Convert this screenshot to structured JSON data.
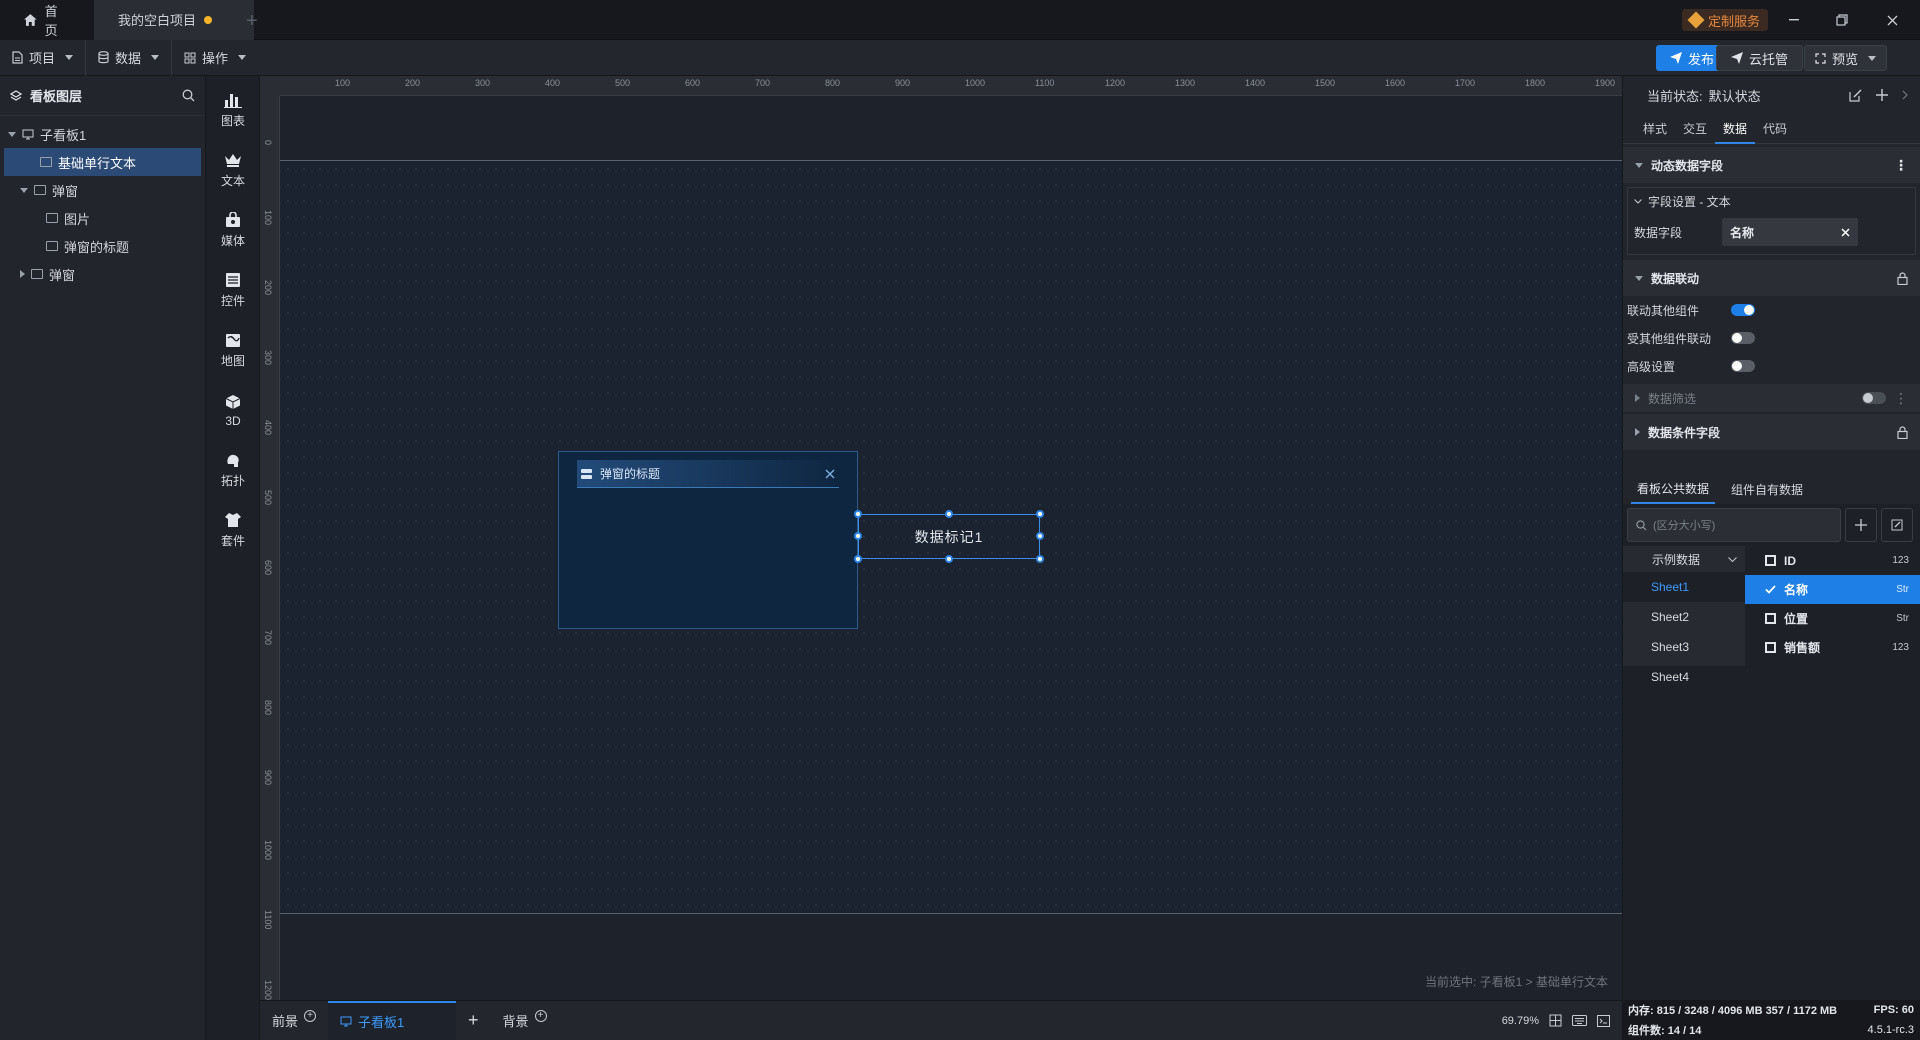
{
  "titlebar": {
    "home_tab": "首页",
    "project_tab": "我的空白项目",
    "custom_service": "定制服务"
  },
  "toolbar": {
    "menu_project": "项目",
    "menu_data": "数据",
    "menu_operate": "操作",
    "publish": "发布",
    "cloud_host": "云托管",
    "preview": "预览"
  },
  "layers": {
    "title": "看板图层",
    "items": [
      {
        "label": "子看板1"
      },
      {
        "label": "基础单行文本"
      },
      {
        "label": "弹窗"
      },
      {
        "label": "图片"
      },
      {
        "label": "弹窗的标题"
      },
      {
        "label": "弹窗"
      }
    ]
  },
  "components": [
    {
      "label": "图表",
      "icon": "bar-chart-icon"
    },
    {
      "label": "文本",
      "icon": "text-crown-icon"
    },
    {
      "label": "媒体",
      "icon": "media-icon"
    },
    {
      "label": "控件",
      "icon": "control-icon"
    },
    {
      "label": "地图",
      "icon": "map-icon"
    },
    {
      "label": "3D",
      "icon": "cube-icon"
    },
    {
      "label": "拓扑",
      "icon": "topology-icon"
    },
    {
      "label": "套件",
      "icon": "kit-icon"
    }
  ],
  "ruler": {
    "h_ticks": [
      "100",
      "200",
      "300",
      "400",
      "500",
      "600",
      "700",
      "800",
      "900",
      "1000",
      "1100",
      "1200",
      "1300",
      "1400",
      "1500",
      "1600",
      "1700",
      "1800",
      "1900"
    ],
    "v_ticks": [
      "0",
      "100",
      "200",
      "300",
      "400",
      "500",
      "600",
      "700",
      "800",
      "900",
      "1000",
      "1100",
      "1200"
    ]
  },
  "canvas": {
    "popup_title": "弹窗的标题",
    "text_widget": "数据标记1",
    "status_text": "当前选中: 子看板1 > 基础单行文本"
  },
  "bottom_tabs": {
    "foreground": "前景",
    "sub_board": "子看板1",
    "background": "背景",
    "zoom": "69.79%"
  },
  "right_panel": {
    "state_label": "当前状态:",
    "state_value": "默认状态",
    "tabs": [
      "样式",
      "交互",
      "数据",
      "代码"
    ],
    "active_tab": "数据",
    "dynamic_fields": "动态数据字段",
    "field_setting": "字段设置 - 文本",
    "data_field_label": "数据字段",
    "data_field_value": "名称",
    "data_linkage": "数据联动",
    "link_other": "联动其他组件",
    "linked_by_other": "受其他组件联动",
    "advanced": "高级设置",
    "data_filter": "数据筛选",
    "condition_fields": "数据条件字段",
    "data_tabs": [
      "看板公共数据",
      "组件自有数据"
    ],
    "search_placeholder": "(区分大小写)",
    "dataset": "示例数据",
    "sheets": [
      "Sheet1",
      "Sheet2",
      "Sheet3",
      "Sheet4"
    ],
    "fields": [
      {
        "name": "ID",
        "type": "123",
        "checked": false
      },
      {
        "name": "名称",
        "type": "Str",
        "checked": true
      },
      {
        "name": "位置",
        "type": "Str",
        "checked": false
      },
      {
        "name": "销售额",
        "type": "123",
        "checked": false
      }
    ],
    "toggles": {
      "link_other": true,
      "linked_by_other": false,
      "advanced": false,
      "data_filter": false
    },
    "accent": "#1e7fe6"
  },
  "statusbar": {
    "memory": "内存: 815 / 3248 / 4096 MB  357 / 1172 MB",
    "fps": "FPS: 60",
    "components": "组件数: 14 / 14",
    "version": "4.5.1-rc.3"
  }
}
